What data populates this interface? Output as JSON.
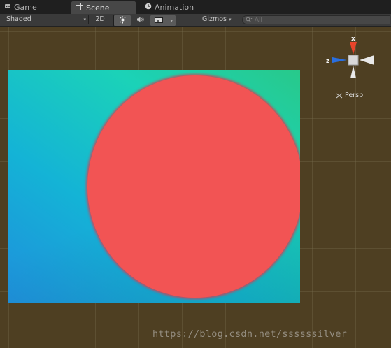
{
  "tabs": [
    {
      "label": "Game",
      "icon": "game-icon"
    },
    {
      "label": "Scene",
      "icon": "scene-grid-icon",
      "active": true
    },
    {
      "label": "Animation",
      "icon": "animation-clock-icon"
    }
  ],
  "toolbar": {
    "shading_mode": "Shaded",
    "mode_2d_label": "2D",
    "lighting_icon": "sun-icon",
    "audio_icon": "speaker-icon",
    "effects_icon": "image-effects-icon",
    "gizmos_label": "Gizmos",
    "search_placeholder": "All",
    "search_icon": "search-icon"
  },
  "scene": {
    "projection_label": "Persp",
    "gizmo_axes": [
      "x",
      "z"
    ],
    "background_color": "#4e3f22",
    "canvas_gradient": [
      "#1f8fdc",
      "#14b3d6",
      "#1bd2b8",
      "#28c98a"
    ],
    "circle_color": "#f25454"
  },
  "watermark": "https://blog.csdn.net/ssssssilver"
}
